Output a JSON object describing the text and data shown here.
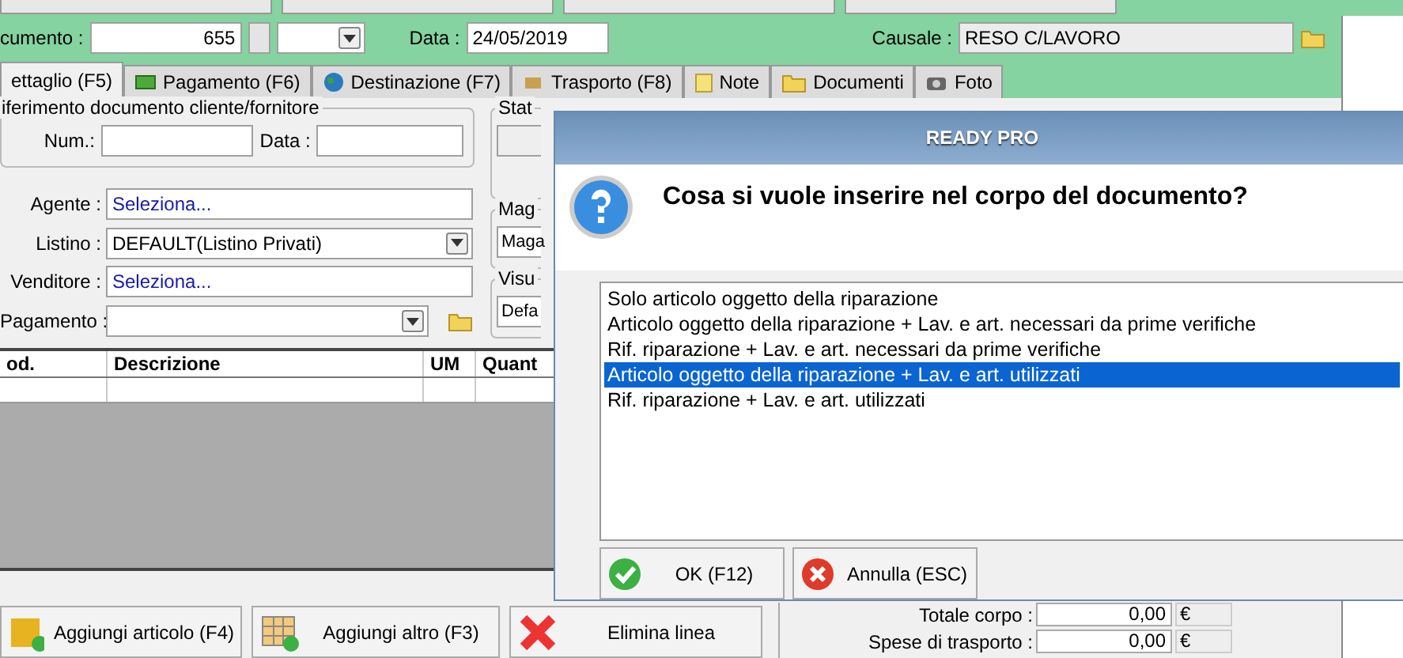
{
  "header": {
    "document_label": "cumento :",
    "document_number": "655",
    "date_label": "Data :",
    "date": "24/05/2019",
    "causale_label": "Causale :",
    "causale": "RESO C/LAVORO"
  },
  "tabs": [
    {
      "label": "ettaglio (F5)",
      "selected": true
    },
    {
      "label": "Pagamento (F6)",
      "selected": false
    },
    {
      "label": "Destinazione (F7)",
      "selected": false
    },
    {
      "label": "Trasporto (F8)",
      "selected": false
    },
    {
      "label": "Note",
      "selected": false
    },
    {
      "label": "Documenti",
      "selected": false
    },
    {
      "label": "Foto",
      "selected": false
    }
  ],
  "reference_group": {
    "title": "iferimento documento cliente/fornitore",
    "num_label": "Num.:",
    "date_label": "Data :"
  },
  "fields": [
    {
      "label": "Agente :",
      "value": "Seleziona...",
      "kind": "link"
    },
    {
      "label": "Listino :",
      "value": "DEFAULT(Listino Privati)",
      "kind": "combo"
    },
    {
      "label": "Venditore :",
      "value": "Seleziona...",
      "kind": "link"
    },
    {
      "label": "Pagamento :",
      "kind": "combo_folder"
    }
  ],
  "side_groups": [
    {
      "title": "Stat"
    },
    {
      "title": "Mag",
      "value": "Maga"
    },
    {
      "title": "Visu",
      "value": "Defa"
    }
  ],
  "table": {
    "columns": [
      "od.",
      "Descrizione",
      "UM",
      "Quant"
    ]
  },
  "bottom_buttons": [
    {
      "label": "Aggiungi articolo (F4)"
    },
    {
      "label": "Aggiungi altro (F3)"
    },
    {
      "label": "Elimina linea"
    }
  ],
  "totals": [
    {
      "label": "Totale corpo :",
      "value": "0,00",
      "currency": "€"
    },
    {
      "label": "Spese di trasporto :",
      "value": "0,00",
      "currency": "€"
    }
  ],
  "dialog": {
    "title": "READY PRO",
    "question": "Cosa si vuole inserire nel corpo del documento?",
    "options": [
      {
        "label": "Solo articolo oggetto della riparazione",
        "selected": false
      },
      {
        "label": "Articolo oggetto della riparazione + Lav. e art. necessari da prime verifiche",
        "selected": false
      },
      {
        "label": "Rif. riparazione + Lav. e art. necessari da prime verifiche",
        "selected": false
      },
      {
        "label": "Articolo oggetto della riparazione + Lav. e art. utilizzati",
        "selected": true
      },
      {
        "label": "Rif. riparazione + Lav. e art. utilizzati",
        "selected": false
      }
    ],
    "buttons": [
      {
        "label": "OK (F12)",
        "kind": "ok"
      },
      {
        "label": "Annulla (ESC)",
        "kind": "cancel"
      }
    ]
  }
}
